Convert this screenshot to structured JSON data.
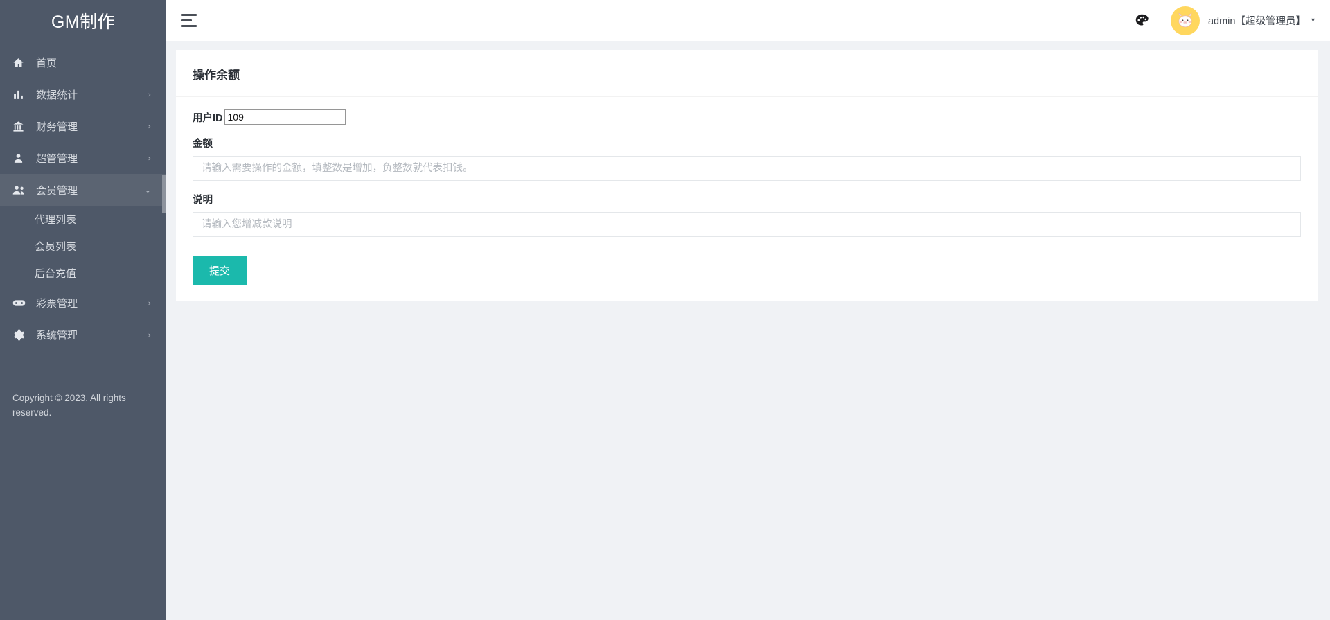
{
  "sidebar": {
    "logo": "GM制作",
    "items": [
      {
        "label": "首页",
        "icon": "home-icon",
        "has_caret": false,
        "active": false
      },
      {
        "label": "数据统计",
        "icon": "bar-chart-icon",
        "has_caret": true,
        "active": false
      },
      {
        "label": "财务管理",
        "icon": "bank-icon",
        "has_caret": true,
        "active": false
      },
      {
        "label": "超管管理",
        "icon": "person-icon",
        "has_caret": true,
        "active": false
      },
      {
        "label": "会员管理",
        "icon": "people-icon",
        "has_caret": true,
        "active": true
      },
      {
        "label": "彩票管理",
        "icon": "gamepad-icon",
        "has_caret": true,
        "active": false
      },
      {
        "label": "系统管理",
        "icon": "gear-icon",
        "has_caret": true,
        "active": false
      }
    ],
    "submenu": [
      {
        "label": "代理列表"
      },
      {
        "label": "会员列表"
      },
      {
        "label": "后台充值"
      }
    ],
    "copyright": "Copyright © 2023. All rights reserved.",
    "background_color": "#4e5868",
    "active_color": "#5b6472"
  },
  "topbar": {
    "menu_toggle_icon": "hamburger-icon",
    "theme_icon": "palette-icon",
    "avatar_icon": "cat-avatar",
    "user_name": "admin【超级管理员】",
    "user_caret": "▾"
  },
  "main": {
    "card_title": "操作余额",
    "user_id": {
      "label": "用户ID",
      "value": "109"
    },
    "amount": {
      "label": "金额",
      "value": "",
      "placeholder": "请输入需要操作的金额，填整数是增加，负整数就代表扣钱。"
    },
    "remark": {
      "label": "说明",
      "value": "",
      "placeholder": "请输入您增减款说明"
    },
    "submit_label": "提交",
    "submit_color": "#1bb9ac"
  }
}
